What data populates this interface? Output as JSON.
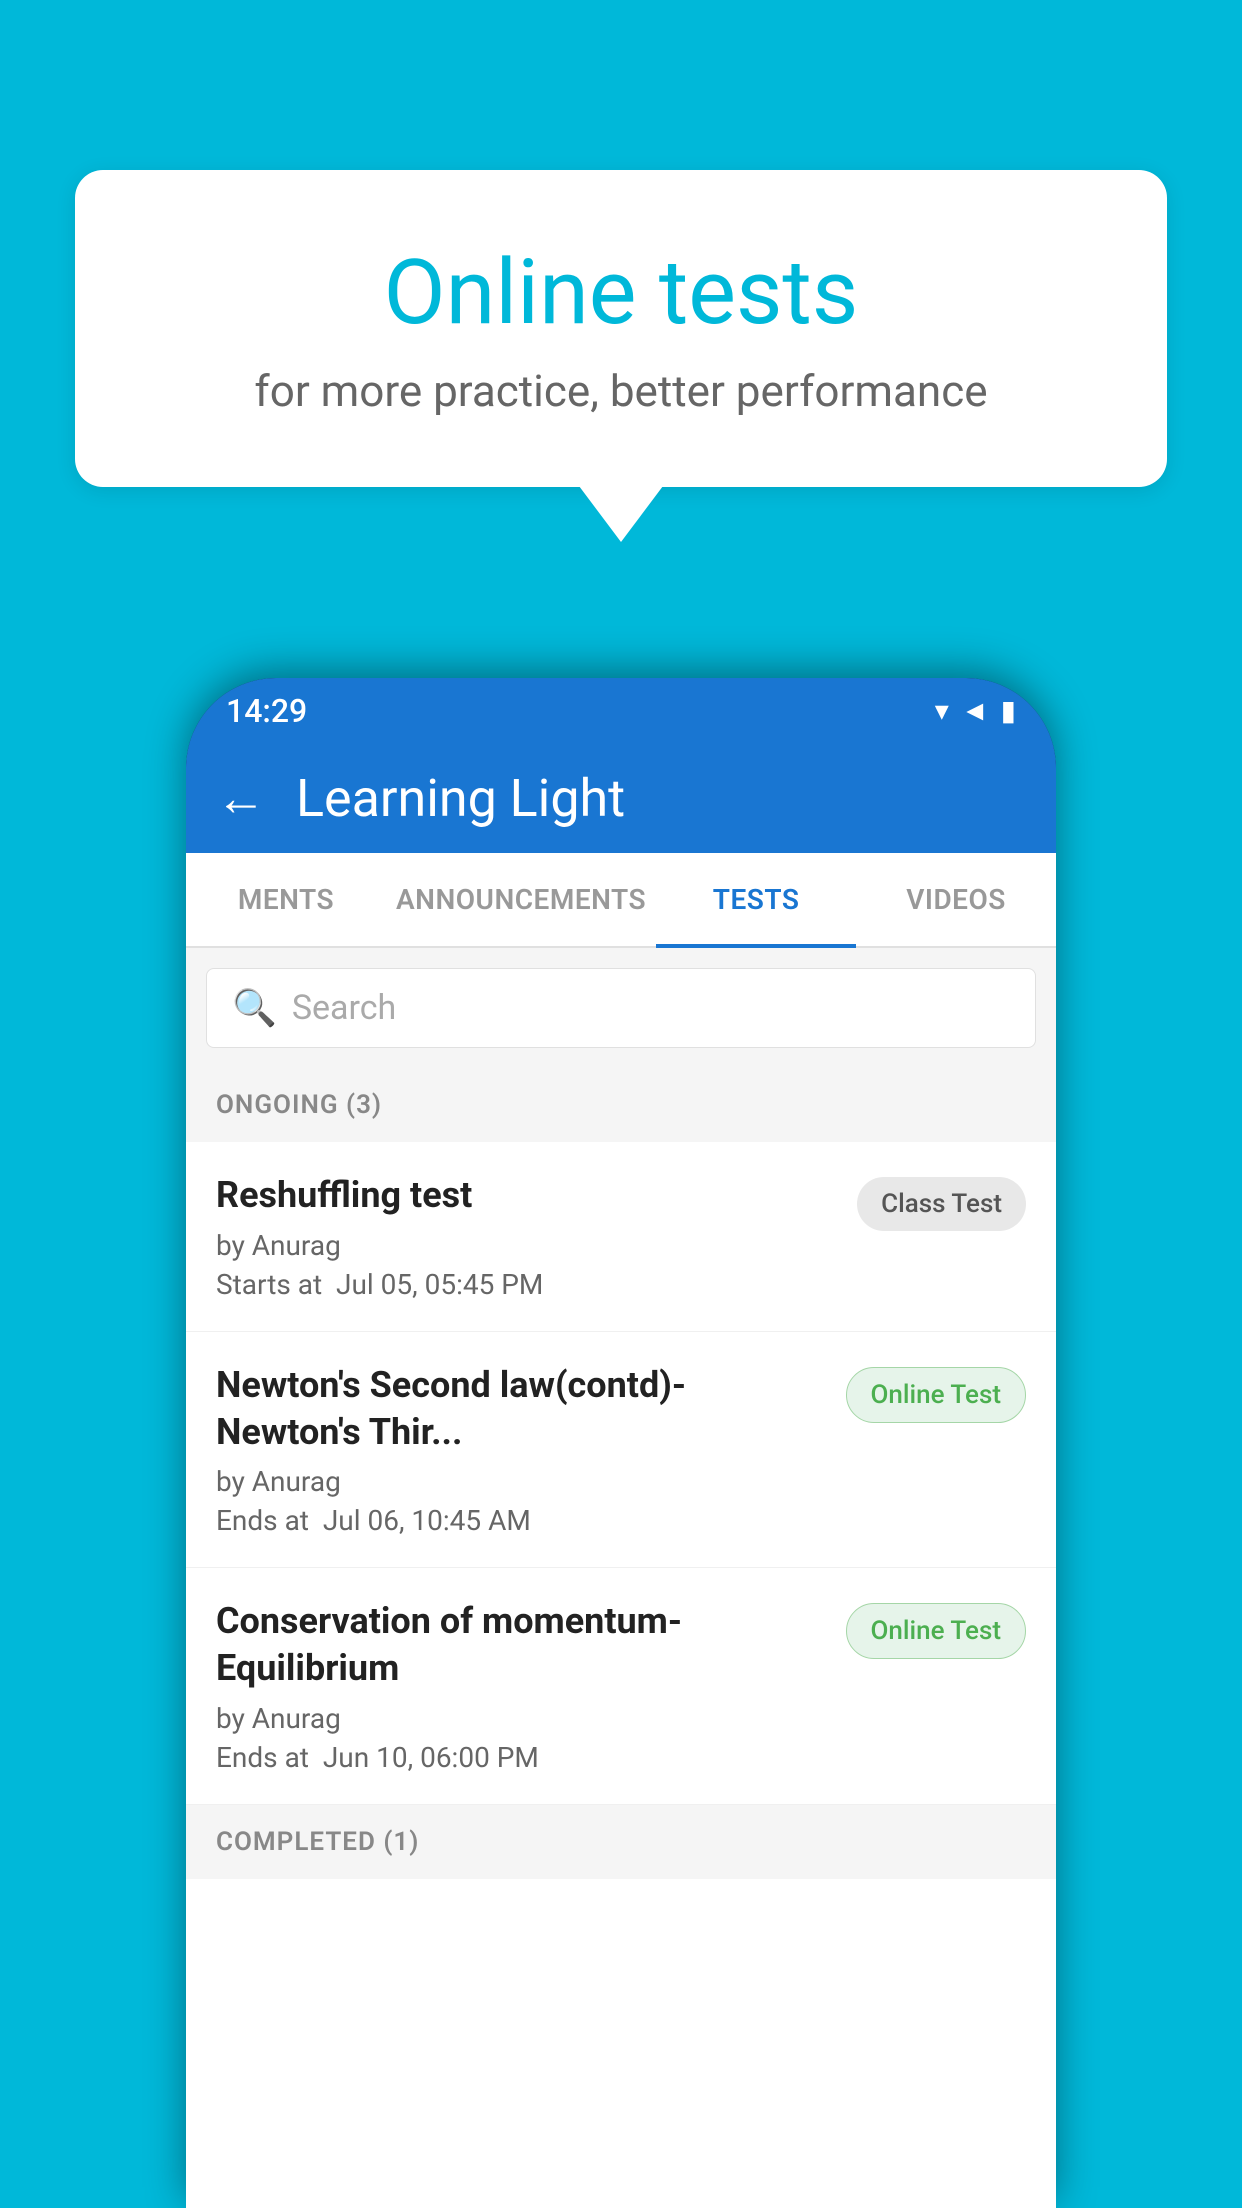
{
  "background_color": "#00B8D9",
  "bubble": {
    "title": "Online tests",
    "subtitle": "for more practice, better performance"
  },
  "status_bar": {
    "time": "14:29",
    "wifi_icon": "▼",
    "signal_icon": "◄",
    "battery_icon": "▮"
  },
  "app_bar": {
    "back_label": "←",
    "title": "Learning Light"
  },
  "tabs": [
    {
      "label": "MENTS",
      "active": false
    },
    {
      "label": "ANNOUNCEMENTS",
      "active": false
    },
    {
      "label": "TESTS",
      "active": true
    },
    {
      "label": "VIDEOS",
      "active": false
    }
  ],
  "search": {
    "placeholder": "Search"
  },
  "ongoing_section": {
    "label": "ONGOING (3)"
  },
  "tests": [
    {
      "name": "Reshuffling test",
      "author": "by Anurag",
      "time_label": "Starts at",
      "time": "Jul 05, 05:45 PM",
      "badge": "Class Test",
      "badge_type": "class"
    },
    {
      "name": "Newton's Second law(contd)-Newton's Thir...",
      "author": "by Anurag",
      "time_label": "Ends at",
      "time": "Jul 06, 10:45 AM",
      "badge": "Online Test",
      "badge_type": "online"
    },
    {
      "name": "Conservation of momentum-Equilibrium",
      "author": "by Anurag",
      "time_label": "Ends at",
      "time": "Jun 10, 06:00 PM",
      "badge": "Online Test",
      "badge_type": "online"
    }
  ],
  "completed_section": {
    "label": "COMPLETED (1)"
  }
}
